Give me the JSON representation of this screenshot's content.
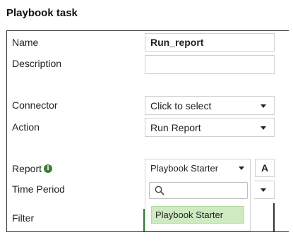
{
  "page_title": "Playbook task",
  "form": {
    "name_label": "Name",
    "name_value": "Run_report",
    "description_label": "Description",
    "description_value": "",
    "connector_label": "Connector",
    "connector_value": "Click to select",
    "action_label": "Action",
    "action_value": "Run Report",
    "report_label": "Report",
    "report_value": "Playbook Starter",
    "time_period_label": "Time Period",
    "filter_label": "Filter",
    "format_button_label": "A"
  },
  "report_dropdown": {
    "search_placeholder": "",
    "options": [
      "Playbook Starter"
    ],
    "highlighted_index": 0
  },
  "colors": {
    "highlight_bg": "#cdeac0",
    "info_icon": "#3f7d3a",
    "border": "#cfcfcf"
  },
  "icons": {
    "info": "info-icon",
    "search": "search-icon",
    "dropdown": "chevron-down-icon"
  }
}
